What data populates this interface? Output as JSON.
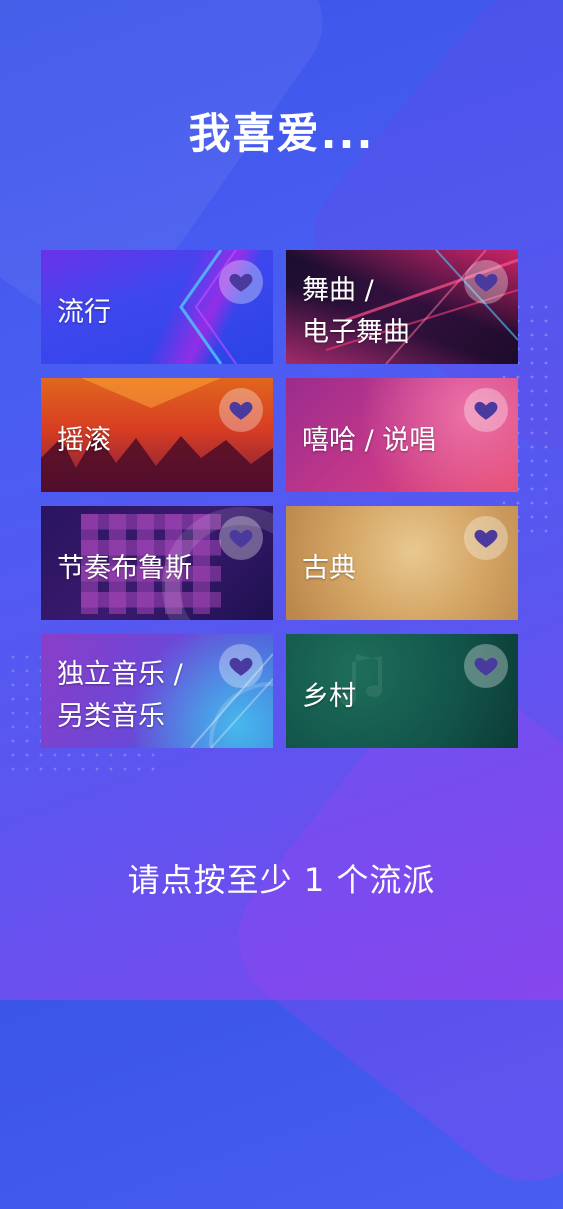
{
  "header": {
    "title": "我喜爱..."
  },
  "genres": [
    {
      "id": "pop",
      "label": "流行"
    },
    {
      "id": "dance",
      "label": "舞曲 /\n电子舞曲"
    },
    {
      "id": "rock",
      "label": "摇滚"
    },
    {
      "id": "hiphop",
      "label": "嘻哈 / 说唱"
    },
    {
      "id": "rnb",
      "label": "节奏布鲁斯"
    },
    {
      "id": "classical",
      "label": "古典"
    },
    {
      "id": "indie",
      "label": "独立音乐 /\n另类音乐"
    },
    {
      "id": "country",
      "label": "乡村"
    }
  ],
  "footer": {
    "prompt": "请点按至少 1 个流派"
  },
  "colors": {
    "heart_fill": "#4b3a9e",
    "heart_bg": "rgba(255,255,255,0.32)"
  }
}
